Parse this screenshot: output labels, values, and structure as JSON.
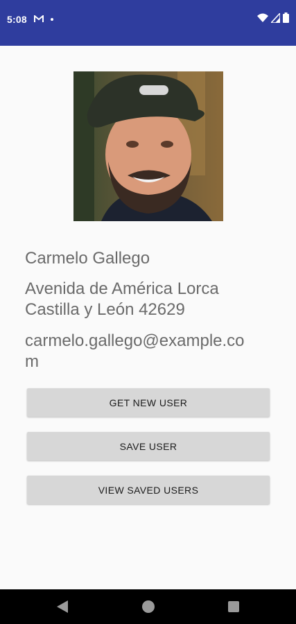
{
  "status_bar": {
    "time": "5:08",
    "notification_icon": "gmail-m-icon",
    "icons": [
      "wifi-icon",
      "cellular-signal-icon",
      "battery-icon"
    ],
    "background_color": "#2f3d9e"
  },
  "user": {
    "name": "Carmelo Gallego",
    "address": "Avenida de América Lorca Castilla y León 42629",
    "email": "carmelo.gallego@example.com"
  },
  "buttons": {
    "get_new_user": "GET NEW USER",
    "save_user": "SAVE USER",
    "view_saved_users": "VIEW SAVED USERS"
  },
  "nav_bar": {
    "icons": [
      "back-icon",
      "home-icon",
      "recents-icon"
    ]
  }
}
